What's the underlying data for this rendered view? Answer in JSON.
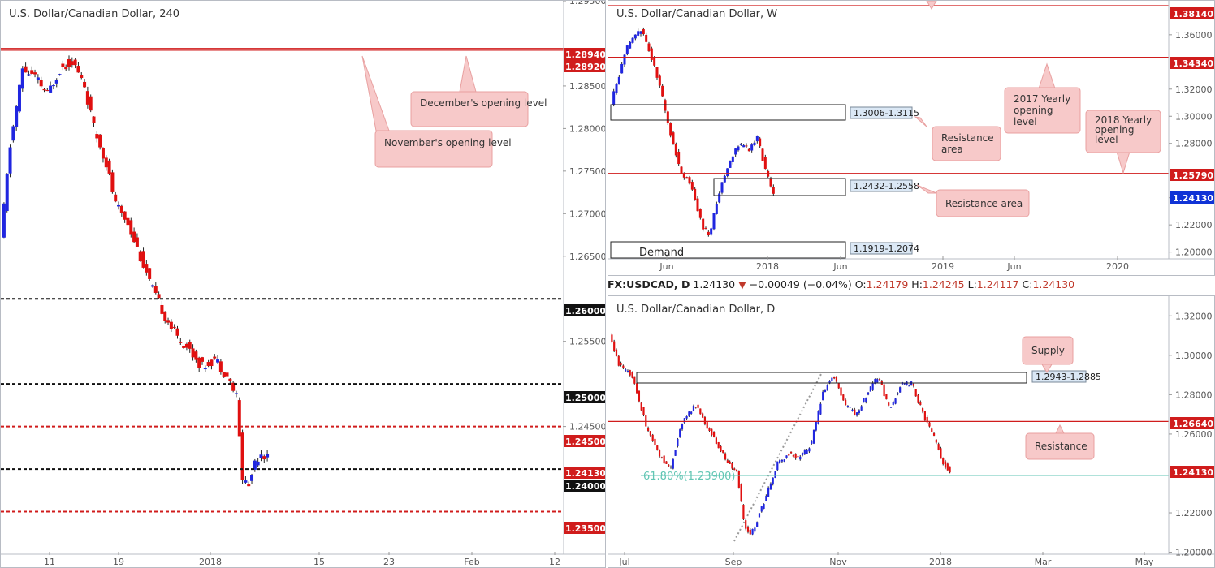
{
  "colors": {
    "bull": "#2026e0",
    "bear": "#e01010",
    "red_level": "#d01c1c",
    "black_level": "#111111",
    "note_bg": "#f7c9c9",
    "note_border": "#e8a0a0",
    "fib": "#62c6b4",
    "price_tag": "#1033d6"
  },
  "panel_h4": {
    "title": "U.S. Dollar/Canadian Dollar, 240",
    "y_ticks": [
      "1.29500",
      "1.28500",
      "1.28000",
      "1.27500",
      "1.27000",
      "1.26500",
      "1.25500",
      "1.24500"
    ],
    "x_ticks": [
      "11",
      "19",
      "2018",
      "15",
      "23",
      "Feb",
      "12"
    ],
    "level_tags": [
      {
        "label": "1.28940",
        "bg": "#d01c1c"
      },
      {
        "label": "1.28920",
        "bg": "#d01c1c"
      },
      {
        "label": "1.26000",
        "bg": "#111111"
      },
      {
        "label": "1.25000",
        "bg": "#111111"
      },
      {
        "label": "1.24500",
        "bg": "#d01c1c"
      },
      {
        "label": "1.24130",
        "bg": "#d01c1c"
      },
      {
        "label": "1.24000",
        "bg": "#111111"
      },
      {
        "label": "1.23500",
        "bg": "#d01c1c"
      }
    ],
    "notes": {
      "december": "December's opening level",
      "november": "November's opening level"
    }
  },
  "panel_w": {
    "title": "U.S. Dollar/Canadian Dollar, W",
    "y_ticks": [
      "1.36000",
      "1.32000",
      "1.30000",
      "1.28000",
      "1.24000",
      "1.22000",
      "1.20000"
    ],
    "x_ticks": [
      "Jun",
      "2018",
      "Jun",
      "2019",
      "Jun",
      "2020"
    ],
    "level_tags": [
      {
        "label": "1.38140",
        "bg": "#d01c1c"
      },
      {
        "label": "1.34340",
        "bg": "#d01c1c"
      },
      {
        "label": "1.25790",
        "bg": "#d01c1c"
      },
      {
        "label": "1.24130",
        "bg": "#1033d6"
      }
    ],
    "zone_labels": [
      "1.3006-1.3115",
      "1.2432-1.2558",
      "1.1919-1.2074"
    ],
    "demand_label": "Demand",
    "notes": {
      "resistance_area_1": "Resistance area",
      "resistance_area_2": "Resistance area",
      "yearly_2017": "2017 Yearly opening level",
      "yearly_2018": "2018 Yearly opening level"
    }
  },
  "info_bar": {
    "symbol": "FX:USDCAD, D",
    "price": "1.24130",
    "arrow": "▼",
    "change": "−0.00049 (−0.04%)",
    "o_label": "O:",
    "o": "1.24179",
    "h_label": "H:",
    "h": "1.24245",
    "l_label": "L:",
    "l": "1.24117",
    "c_label": "C:",
    "c": "1.24130"
  },
  "panel_d": {
    "title": "U.S. Dollar/Canadian Dollar, D",
    "y_ticks": [
      "1.32000",
      "1.30000",
      "1.28000",
      "1.26000",
      "1.22000",
      "1.20000"
    ],
    "x_ticks": [
      "Jul",
      "Sep",
      "Nov",
      "2018",
      "Mar",
      "May"
    ],
    "level_tags": [
      {
        "label": "1.26640",
        "bg": "#d01c1c"
      },
      {
        "label": "1.24130",
        "bg": "#d01c1c"
      }
    ],
    "zone_label": "1.2943-1.2885",
    "fib_label": "61.80%(1.23900)",
    "notes": {
      "supply": "Supply",
      "resistance": "Resistance"
    }
  },
  "chart_data": [
    {
      "type": "candlestick",
      "title": "U.S. Dollar/Canadian Dollar, 240",
      "y_range": [
        1.23,
        1.295
      ],
      "levels": [
        1.2894,
        1.2892,
        1.26,
        1.25,
        1.245,
        1.24,
        1.235
      ],
      "key_path": [
        [
          0,
          1.267
        ],
        [
          3,
          1.278
        ],
        [
          7,
          1.287
        ],
        [
          11,
          1.286
        ],
        [
          15,
          1.284
        ],
        [
          19,
          1.287
        ],
        [
          23,
          1.288
        ],
        [
          27,
          1.285
        ],
        [
          30,
          1.28
        ],
        [
          34,
          1.276
        ],
        [
          37,
          1.271
        ],
        [
          41,
          1.269
        ],
        [
          45,
          1.265
        ],
        [
          49,
          1.261
        ],
        [
          53,
          1.258
        ],
        [
          57,
          1.2555
        ],
        [
          61,
          1.254
        ],
        [
          65,
          1.252
        ],
        [
          69,
          1.253
        ],
        [
          73,
          1.251
        ],
        [
          76,
          1.2485
        ],
        [
          78,
          1.239
        ],
        [
          80,
          1.238
        ],
        [
          82,
          1.241
        ],
        [
          84,
          1.242
        ],
        [
          86,
          1.2413
        ]
      ]
    },
    {
      "type": "candlestick",
      "title": "U.S. Dollar/Canadian Dollar, W",
      "y_range": [
        1.195,
        1.385
      ],
      "levels": [
        1.3814,
        1.3434,
        1.2579
      ],
      "zones": [
        [
          1.3006,
          1.3115
        ],
        [
          1.2432,
          1.2558
        ],
        [
          1.1919,
          1.2074
        ]
      ],
      "key_path": [
        [
          0,
          1.31
        ],
        [
          6,
          1.35
        ],
        [
          11,
          1.365
        ],
        [
          14,
          1.35
        ],
        [
          18,
          1.325
        ],
        [
          22,
          1.29
        ],
        [
          26,
          1.26
        ],
        [
          30,
          1.25
        ],
        [
          34,
          1.22
        ],
        [
          37,
          1.212
        ],
        [
          40,
          1.24
        ],
        [
          44,
          1.265
        ],
        [
          48,
          1.28
        ],
        [
          52,
          1.275
        ],
        [
          55,
          1.285
        ],
        [
          58,
          1.26
        ],
        [
          61,
          1.2413
        ]
      ]
    },
    {
      "type": "candlestick",
      "title": "U.S. Dollar/Canadian Dollar, D",
      "y_range": [
        1.199,
        1.33
      ],
      "levels": [
        1.2664
      ],
      "zones": [
        [
          1.2885,
          1.2943
        ]
      ],
      "fib": {
        "label": "61.80%",
        "value": 1.239
      },
      "key_path": [
        [
          0,
          1.31
        ],
        [
          4,
          1.295
        ],
        [
          10,
          1.29
        ],
        [
          16,
          1.265
        ],
        [
          22,
          1.25
        ],
        [
          27,
          1.242
        ],
        [
          32,
          1.265
        ],
        [
          38,
          1.275
        ],
        [
          43,
          1.265
        ],
        [
          48,
          1.255
        ],
        [
          53,
          1.245
        ],
        [
          57,
          1.24
        ],
        [
          60,
          1.215
        ],
        [
          63,
          1.208
        ],
        [
          67,
          1.22
        ],
        [
          71,
          1.232
        ],
        [
          75,
          1.245
        ],
        [
          80,
          1.25
        ],
        [
          85,
          1.248
        ],
        [
          90,
          1.255
        ],
        [
          95,
          1.28
        ],
        [
          100,
          1.29
        ],
        [
          105,
          1.275
        ],
        [
          110,
          1.27
        ],
        [
          115,
          1.28
        ],
        [
          120,
          1.29
        ],
        [
          125,
          1.272
        ],
        [
          130,
          1.285
        ],
        [
          135,
          1.286
        ],
        [
          140,
          1.27
        ],
        [
          145,
          1.258
        ],
        [
          149,
          1.245
        ],
        [
          152,
          1.2413
        ]
      ]
    }
  ]
}
